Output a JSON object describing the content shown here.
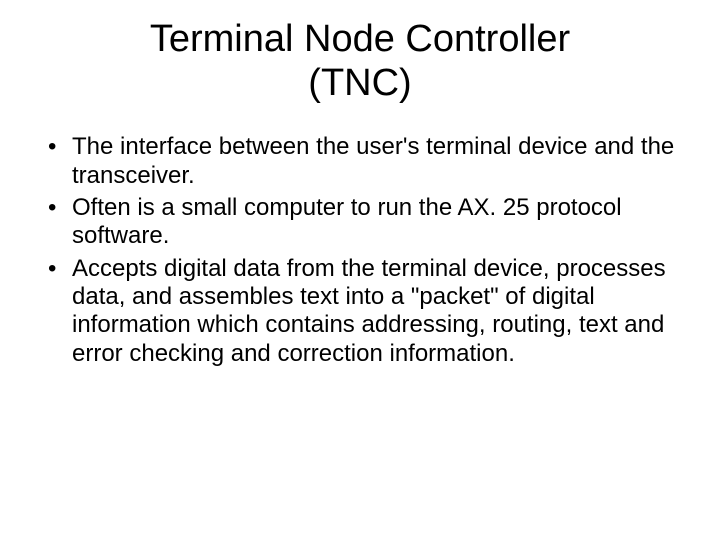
{
  "title_line1": "Terminal Node Controller",
  "title_line2": "(TNC)",
  "bullets": [
    "The interface between the user's terminal device and the transceiver.",
    "Often is a small computer to run the AX. 25 protocol software.",
    "Accepts digital data from the terminal device, processes data, and assembles text into a \"packet\" of digital information which contains addressing, routing, text and error checking and correction information."
  ]
}
